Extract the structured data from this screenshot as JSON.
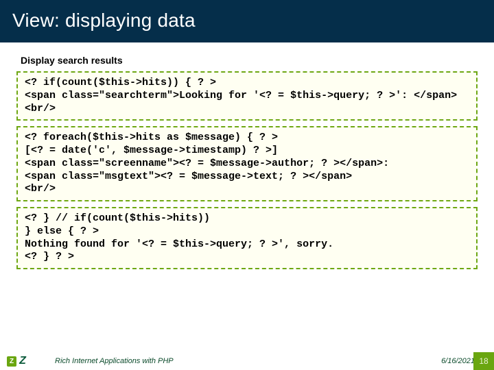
{
  "title": "View: displaying data",
  "subtitle": "Display search results",
  "code_blocks": [
    "<? if(count($this->hits)) { ? >\n<span class=\"searchterm\">Looking for '<? = $this->query; ? >': </span><br/>",
    "<? foreach($this->hits as $message) { ? >\n[<? = date('c', $message->timestamp) ? >]\n<span class=\"screenname\"><? = $message->author; ? ></span>:\n<span class=\"msgtext\"><? = $message->text; ? ></span>\n<br/>",
    "<? } // if(count($this->hits))\n} else { ? >\nNothing found for '<? = $this->query; ? >', sorry.\n<? } ? >"
  ],
  "footer": {
    "title": "Rich Internet Applications with PHP",
    "date": "6/16/2021",
    "page": "18",
    "badge": "Z"
  }
}
